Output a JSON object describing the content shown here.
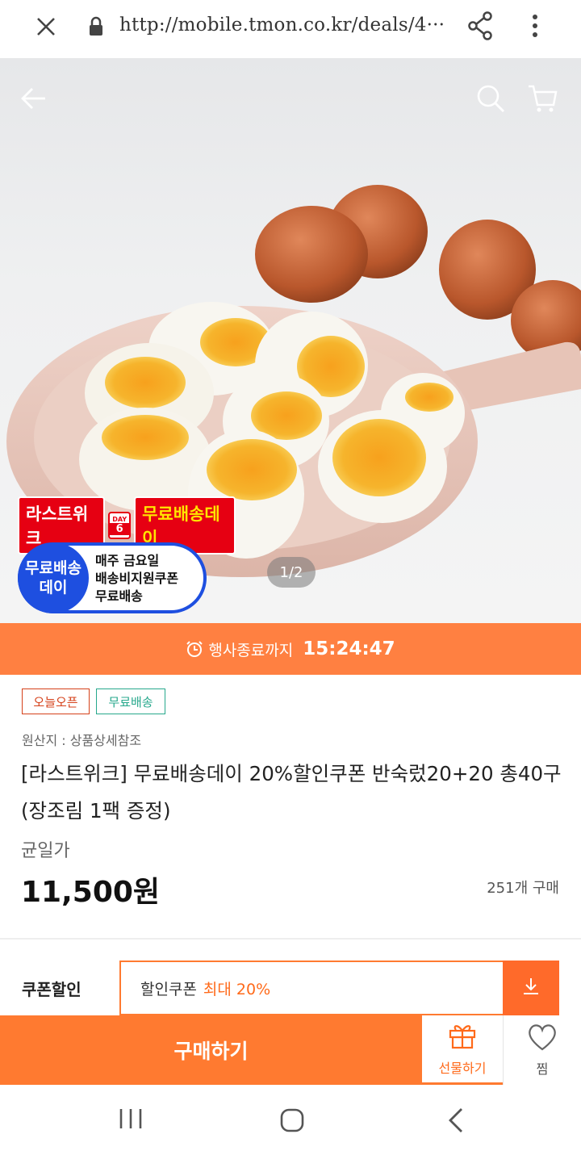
{
  "browser": {
    "url": "http://mobile.tmon.co.kr/deals/4···"
  },
  "hero": {
    "page_indicator": "1/2",
    "promo": {
      "title": "라스트위크",
      "day_label": "DAY",
      "day_number": "6",
      "free_shipping_day": "무료배송데이",
      "circle_line1": "무료배송",
      "circle_line2": "데이",
      "line1": "매주 금요일",
      "line2": "배송비지원쿠폰",
      "line3": "무료배송"
    }
  },
  "timer": {
    "label": "행사종료까지",
    "value": "15:24:47"
  },
  "tags": {
    "open": "오늘오픈",
    "shipping": "무료배송"
  },
  "product": {
    "origin": "원산지 : 상품상세참조",
    "title": "[라스트위크] 무료배송데이 20%할인쿠폰 반숙렀20+20 총40구(장조림 1팩 증정)",
    "price_label": "균일가",
    "price": "11,500원",
    "sold": "251개 구매"
  },
  "coupon": {
    "label": "쿠폰할인",
    "text": "할인쿠폰",
    "max": "최대 20%"
  },
  "actions": {
    "buy": "구매하기",
    "gift": "선물하기",
    "wish": "찜"
  },
  "colors": {
    "accent": "#ff7a30",
    "timer_bg": "#ff8041",
    "tag_open": "#d5411a",
    "tag_shipping": "#27a88c"
  },
  "icons": {
    "browser": [
      "close-icon",
      "lock-icon",
      "share-icon",
      "more-vert-icon"
    ],
    "hero": [
      "back-arrow-icon",
      "search-icon",
      "cart-icon"
    ],
    "nav": [
      "recent-apps-icon",
      "home-icon",
      "back-icon"
    ]
  }
}
